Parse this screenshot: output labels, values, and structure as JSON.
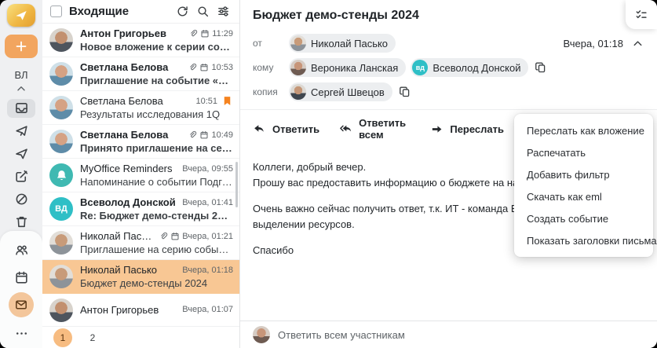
{
  "colors": {
    "accent_orange": "#F2A55F",
    "selection_orange": "#F8C794",
    "pagination_orange": "#F7BC81",
    "teal_avatar": "#2FBFC6",
    "reminder_teal": "#3FB9B2",
    "bookmark_orange": "#F5831F",
    "rail_background": "#EFF0F2"
  },
  "rail": {
    "profile_initials": "ВЛ",
    "icons": [
      "app-logo",
      "plus",
      "collapse-chevron",
      "inbox",
      "sent",
      "outgoing",
      "compose",
      "spam",
      "trash",
      "contacts",
      "calendar",
      "mail",
      "more"
    ]
  },
  "list": {
    "header": {
      "title": "Входящие",
      "icons": [
        "select-checkbox",
        "refresh",
        "search",
        "filter"
      ]
    },
    "rows": [
      {
        "sender": "Антон Григорьев",
        "subject": "Новое вложение к серии событий «Аналити...",
        "time": "11:29",
        "unread": true,
        "attach": true,
        "cal": true,
        "bookmark": false,
        "selected": false,
        "avatar": "anton"
      },
      {
        "sender": "Светлана Белова",
        "subject": "Приглашение на событие «Предварительно...",
        "time": "10:53",
        "unread": true,
        "attach": true,
        "cal": true,
        "bookmark": false,
        "selected": false,
        "avatar": "svetlana"
      },
      {
        "sender": "Светлана Белова",
        "subject": "Результаты исследования 1Q",
        "time": "10:51",
        "unread": false,
        "attach": false,
        "cal": false,
        "bookmark": true,
        "selected": false,
        "avatar": "svetlana"
      },
      {
        "sender": "Светлана Белова",
        "subject": "Принято приглашение на серию событий «...",
        "time": "10:49",
        "unread": true,
        "attach": true,
        "cal": true,
        "bookmark": false,
        "selected": false,
        "avatar": "svetlana"
      },
      {
        "sender": "MyOffice Reminders",
        "subject": "Напоминание о событии Подготовить отчет...",
        "time": "Вчера, 09:55",
        "unread": false,
        "attach": false,
        "cal": false,
        "bookmark": false,
        "selected": false,
        "avatar": "bell"
      },
      {
        "sender": "Всеволод Донской",
        "subject": "Re: Бюджет демо-стенды 2024",
        "time": "Вчера, 01:41",
        "unread": true,
        "attach": false,
        "cal": false,
        "bookmark": false,
        "selected": false,
        "avatar": "vd"
      },
      {
        "sender": "Николай Пасько",
        "subject": "Приглашение на серию событий «Демо стен...",
        "time": "Вчера, 01:21",
        "unread": false,
        "attach": true,
        "cal": true,
        "bookmark": false,
        "selected": false,
        "avatar": "nikolay"
      },
      {
        "sender": "Николай Пасько",
        "subject": "Бюджет демо-стенды 2024",
        "time": "Вчера, 01:18",
        "unread": false,
        "attach": false,
        "cal": false,
        "bookmark": false,
        "selected": true,
        "avatar": "nikolay"
      },
      {
        "sender": "Антон Григорьев",
        "subject": "",
        "time": "Вчера, 01:07",
        "unread": false,
        "attach": false,
        "cal": false,
        "bookmark": false,
        "selected": false,
        "avatar": "anton"
      }
    ],
    "pagination": {
      "current": "1",
      "pages": [
        "1",
        "2"
      ]
    }
  },
  "message": {
    "subject": "Бюджет демо-стенды 2024",
    "date": "Вчера, 01:18",
    "from": {
      "label": "от",
      "recipients": [
        {
          "name": "Николай Пасько",
          "avatar": "nikolay"
        }
      ],
      "copy": false
    },
    "to": {
      "label": "кому",
      "recipients": [
        {
          "name": "Вероника Ланская",
          "avatar": "veronika"
        },
        {
          "name": "Всеволод Донской",
          "avatar": "vd_small"
        }
      ],
      "copy": true
    },
    "cc": {
      "label": "копия",
      "recipients": [
        {
          "name": "Сергей Швецов",
          "avatar": "sergey"
        }
      ],
      "copy": true
    },
    "toolbar": {
      "reply": "Ответить",
      "reply_all": "Ответить всем",
      "forward": "Переслать",
      "icons": [
        "open-in-new-window",
        "delete",
        "tag",
        "more-kebab"
      ]
    },
    "body": [
      [
        "Коллеги, добрый вечер.",
        "Прошу вас предоставить информацию о бюджете на наши демонстраци"
      ],
      [
        "Очень важно сейчас получить ответ, т.к. ИТ - команда Всеволода, уже",
        "выделении ресурсов."
      ],
      [
        "Спасибо"
      ]
    ],
    "reply_placeholder": "Ответить всем участникам",
    "reply_avatar": "veronika"
  },
  "menu": {
    "items": [
      "Переслать как вложение",
      "Распечатать",
      "Добавить фильтр",
      "Скачать как eml",
      "Создать событие",
      "Показать заголовки письма"
    ]
  },
  "flap_icon": "tasks-checklist",
  "avatars": {
    "anton": {
      "type": "photo",
      "bg": "#D8D3CC",
      "face": "#C2906F",
      "cloth": "#4E555E"
    },
    "svetlana": {
      "type": "photo",
      "bg": "#CFE0E8",
      "face": "#D5A284",
      "cloth": "#5E8CA8"
    },
    "nikolay": {
      "type": "photo",
      "bg": "#E2DED8",
      "face": "#C89B79",
      "cloth": "#8D9399"
    },
    "veronika": {
      "type": "photo",
      "bg": "#D6CCC4",
      "face": "#C79579",
      "cloth": "#6E5B52"
    },
    "sergey": {
      "type": "photo",
      "bg": "#DCD8D2",
      "face": "#C49677",
      "cloth": "#3F464E"
    },
    "vd": {
      "type": "initials",
      "text": "ВД",
      "bg": "#2FBFC6",
      "font": 11
    },
    "vd_small": {
      "type": "initials",
      "text": "вд",
      "bg": "#2FBFC6",
      "font": 9
    },
    "bell": {
      "type": "icon",
      "icon": "bell",
      "bg": "#3FB9B2"
    }
  }
}
